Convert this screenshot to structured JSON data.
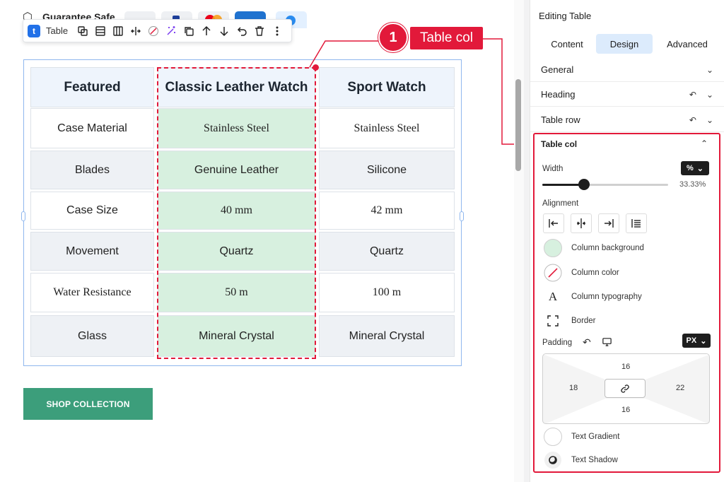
{
  "site": {
    "brand": "Guarantee Safe"
  },
  "toolbar": {
    "block_badge": "t",
    "block_label": "Table"
  },
  "callout": {
    "number": "1",
    "label": "Table col"
  },
  "table": {
    "headers": [
      "Featured",
      "Classic Leather Watch",
      "Sport Watch"
    ],
    "rows": [
      [
        "Case Material",
        "Stainless Steel",
        "Stainless Steel"
      ],
      [
        "Blades",
        "Genuine Leather",
        "Silicone"
      ],
      [
        "Case Size",
        "40 mm",
        "42 mm"
      ],
      [
        "Movement",
        "Quartz",
        "Quartz"
      ],
      [
        "Water Resistance",
        "50 m",
        "100 m"
      ],
      [
        "Glass",
        "Mineral Crystal",
        "Mineral Crystal"
      ]
    ]
  },
  "shop_button": "SHOP COLLECTION",
  "panel": {
    "title": "Editing Table",
    "tabs": [
      "Content",
      "Design",
      "Advanced"
    ],
    "active_tab": "Design",
    "sections": [
      "General",
      "Heading",
      "Table row"
    ],
    "table_col": {
      "title": "Table col",
      "width_label": "Width",
      "width_unit": "%",
      "width_value": "33.33%",
      "width_fraction": 0.3333,
      "alignment_label": "Alignment",
      "options": [
        "Column background",
        "Column color",
        "Column typography",
        "Border"
      ],
      "column_background_color": "#d7f0df",
      "padding_label": "Padding",
      "padding_unit": "PX",
      "padding": {
        "top": "16",
        "right": "22",
        "bottom": "16",
        "left": "18"
      },
      "text_gradient": "Text Gradient",
      "text_shadow": "Text Shadow"
    }
  },
  "colors": {
    "accent": "#e2193a",
    "primary_blue": "#2271e8",
    "shop_green": "#3c9e7b",
    "active_tab_bg": "#dcebfc"
  }
}
